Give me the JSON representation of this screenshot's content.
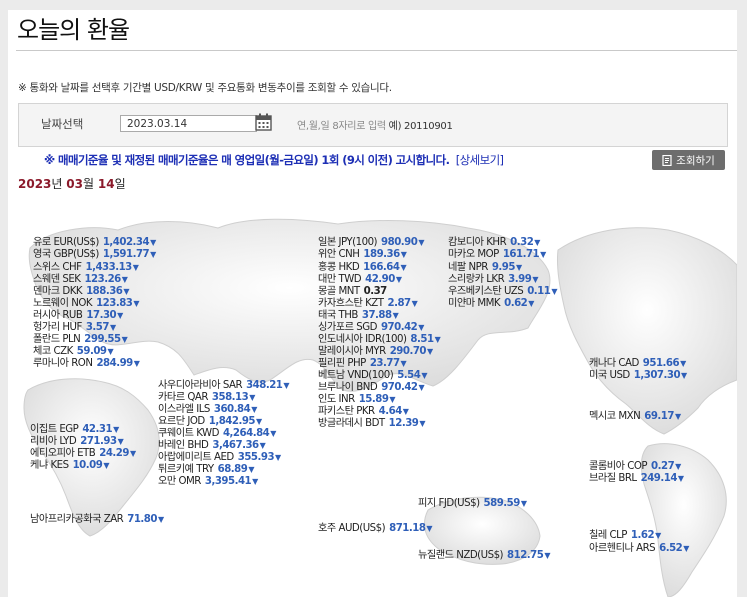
{
  "page": {
    "title": "오늘의 환율",
    "notice": "※ 통화와 날짜를 선택후 기간별 USD/KRW 및 주요통화 변동추이를 조회할 수 있습니다."
  },
  "search": {
    "label": "날짜선택",
    "date_value": "2023.03.14",
    "hint_prefix": "연,월,일 8자리로 입력",
    "hint_example": "예) 20110901"
  },
  "banner": {
    "text": "※ 매매기준율 및 재정된 매매기준율은 매 영업일(월-금요일) 1회 (9시 이전) 고시합니다.",
    "detail_link": "[상세보기]",
    "query_button": "조회하기"
  },
  "date_heading": {
    "year": "2023",
    "y_unit": "년",
    "month": "03",
    "m_unit": "월",
    "day": "14",
    "d_unit": "일"
  },
  "icons": {
    "calendar": "calendar-icon",
    "query": "document-icon",
    "down": "down-triangle-icon"
  },
  "colors": {
    "value_blue": "#2f5fb8",
    "banner_blue": "#1d2fb5",
    "date_red": "#8b1a2b"
  },
  "rates": [
    {
      "name": "유로 EUR(US$)",
      "value": "1,402.34",
      "trend": "down"
    },
    {
      "name": "영국 GBP(US$)",
      "value": "1,591.77",
      "trend": "down"
    },
    {
      "name": "스위스 CHF",
      "value": "1,433.13",
      "trend": "down"
    },
    {
      "name": "스웨덴 SEK",
      "value": "123.26",
      "trend": "down"
    },
    {
      "name": "덴마크 DKK",
      "value": "188.36",
      "trend": "down"
    },
    {
      "name": "노르웨이 NOK",
      "value": "123.83",
      "trend": "down"
    },
    {
      "name": "러시아 RUB",
      "value": "17.30",
      "trend": "down"
    },
    {
      "name": "헝가리 HUF",
      "value": "3.57",
      "trend": "down"
    },
    {
      "name": "폴란드 PLN",
      "value": "299.55",
      "trend": "down"
    },
    {
      "name": "체코 CZK",
      "value": "59.09",
      "trend": "down"
    },
    {
      "name": "루마니아 RON",
      "value": "284.99",
      "trend": "down"
    },
    {
      "name": "일본 JPY(100)",
      "value": "980.90",
      "trend": "down"
    },
    {
      "name": "위안 CNH",
      "value": "189.36",
      "trend": "down"
    },
    {
      "name": "홍콩 HKD",
      "value": "166.64",
      "trend": "down"
    },
    {
      "name": "대만 TWD",
      "value": "42.90",
      "trend": "down"
    },
    {
      "name": "몽골 MNT",
      "value": "0.37",
      "trend": "flat"
    },
    {
      "name": "카자흐스탄 KZT",
      "value": "2.87",
      "trend": "down"
    },
    {
      "name": "태국 THB",
      "value": "37.88",
      "trend": "down"
    },
    {
      "name": "싱가포르 SGD",
      "value": "970.42",
      "trend": "down"
    },
    {
      "name": "인도네시아 IDR(100)",
      "value": "8.51",
      "trend": "down"
    },
    {
      "name": "말레이시아 MYR",
      "value": "290.70",
      "trend": "down"
    },
    {
      "name": "필리핀 PHP",
      "value": "23.77",
      "trend": "down"
    },
    {
      "name": "베트남 VND(100)",
      "value": "5.54",
      "trend": "down"
    },
    {
      "name": "브루나이 BND",
      "value": "970.42",
      "trend": "down"
    },
    {
      "name": "인도 INR",
      "value": "15.89",
      "trend": "down"
    },
    {
      "name": "파키스탄 PKR",
      "value": "4.64",
      "trend": "down"
    },
    {
      "name": "방글라데시 BDT",
      "value": "12.39",
      "trend": "down"
    },
    {
      "name": "캄보디아 KHR",
      "value": "0.32",
      "trend": "down"
    },
    {
      "name": "마카오 MOP",
      "value": "161.71",
      "trend": "down"
    },
    {
      "name": "네팔 NPR",
      "value": "9.95",
      "trend": "down"
    },
    {
      "name": "스리랑카 LKR",
      "value": "3.99",
      "trend": "down"
    },
    {
      "name": "우즈베키스탄 UZS",
      "value": "0.11",
      "trend": "down"
    },
    {
      "name": "미얀마 MMK",
      "value": "0.62",
      "trend": "down"
    },
    {
      "name": "사우디아라비아 SAR",
      "value": "348.21",
      "trend": "down"
    },
    {
      "name": "카타르 QAR",
      "value": "358.13",
      "trend": "down"
    },
    {
      "name": "이스라엘 ILS",
      "value": "360.84",
      "trend": "down"
    },
    {
      "name": "요르단 JOD",
      "value": "1,842.95",
      "trend": "down"
    },
    {
      "name": "쿠웨이트 KWD",
      "value": "4,264.84",
      "trend": "down"
    },
    {
      "name": "바레인 BHD",
      "value": "3,467.36",
      "trend": "down"
    },
    {
      "name": "아랍에미리트 AED",
      "value": "355.93",
      "trend": "down"
    },
    {
      "name": "튀르키예 TRY",
      "value": "68.89",
      "trend": "down"
    },
    {
      "name": "오만 OMR",
      "value": "3,395.41",
      "trend": "down"
    },
    {
      "name": "이집트 EGP",
      "value": "42.31",
      "trend": "down"
    },
    {
      "name": "리비아 LYD",
      "value": "271.93",
      "trend": "down"
    },
    {
      "name": "에티오피아 ETB",
      "value": "24.29",
      "trend": "down"
    },
    {
      "name": "케냐 KES",
      "value": "10.09",
      "trend": "down"
    },
    {
      "name": "남아프리카공화국 ZAR",
      "value": "71.80",
      "trend": "down"
    },
    {
      "name": "피지 FJD(US$)",
      "value": "589.59",
      "trend": "down"
    },
    {
      "name": "호주 AUD(US$)",
      "value": "871.18",
      "trend": "down"
    },
    {
      "name": "뉴질랜드 NZD(US$)",
      "value": "812.75",
      "trend": "down"
    },
    {
      "name": "캐나다 CAD",
      "value": "951.66",
      "trend": "down"
    },
    {
      "name": "미국 USD",
      "value": "1,307.30",
      "trend": "down"
    },
    {
      "name": "멕시코 MXN",
      "value": "69.17",
      "trend": "down"
    },
    {
      "name": "콜롬비아 COP",
      "value": "0.27",
      "trend": "down"
    },
    {
      "name": "브라질 BRL",
      "value": "249.14",
      "trend": "down"
    },
    {
      "name": "칠레 CLP",
      "value": "1.62",
      "trend": "down"
    },
    {
      "name": "아르헨티나 ARS",
      "value": "6.52",
      "trend": "down"
    }
  ]
}
